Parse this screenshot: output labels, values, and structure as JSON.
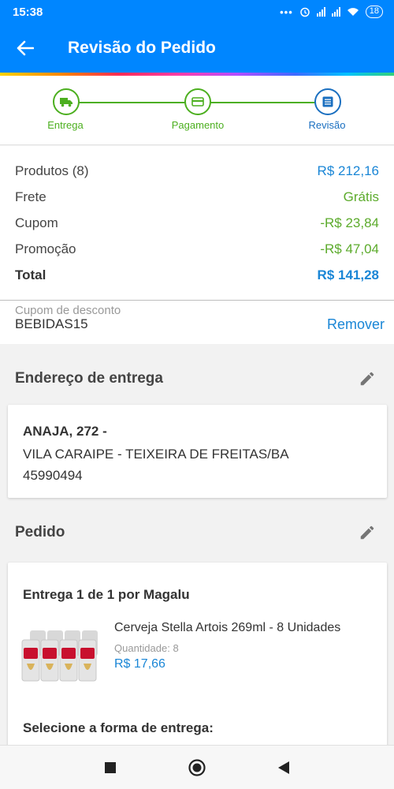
{
  "status_bar": {
    "time": "15:38",
    "battery": "18"
  },
  "header": {
    "title": "Revisão do Pedido"
  },
  "steps": [
    {
      "label": "Entrega",
      "state": "done",
      "color": "#4caf1f"
    },
    {
      "label": "Pagamento",
      "state": "done",
      "color": "#4caf1f"
    },
    {
      "label": "Revisão",
      "state": "current",
      "color": "#1a6fc0"
    }
  ],
  "summary": {
    "products_label": "Produtos (8)",
    "products_value": "R$ 212,16",
    "shipping_label": "Frete",
    "shipping_value": "Grátis",
    "coupon_label": "Cupom",
    "coupon_value": "-R$ 23,84",
    "promo_label": "Promoção",
    "promo_value": "-R$ 47,04",
    "total_label": "Total",
    "total_value": "R$ 141,28"
  },
  "coupon": {
    "label": "Cupom de desconto",
    "code": "BEBIDAS15",
    "remove_label": "Remover"
  },
  "address_section": {
    "title": "Endereço de entrega",
    "line1": "ANAJA, 272 -",
    "line2": "VILA CARAIPE - TEIXEIRA DE FREITAS/BA",
    "line3": "45990494"
  },
  "order_section": {
    "title": "Pedido",
    "delivery_title": "Entrega 1 de 1 por Magalu",
    "product_name": "Cerveja Stella Artois 269ml - 8 Unidades",
    "quantity": "Quantidade:  8",
    "price": "R$ 17,66",
    "shipping_prompt": "Selecione a forma de entrega:"
  },
  "colors": {
    "primary": "#0086ff",
    "success": "#5cab2c",
    "link": "#1a86d6"
  },
  "icons": [
    "back-arrow-icon",
    "truck-icon",
    "card-icon",
    "list-icon",
    "pencil-icon",
    "nav-back-icon",
    "nav-home-icon",
    "nav-recents-icon"
  ]
}
